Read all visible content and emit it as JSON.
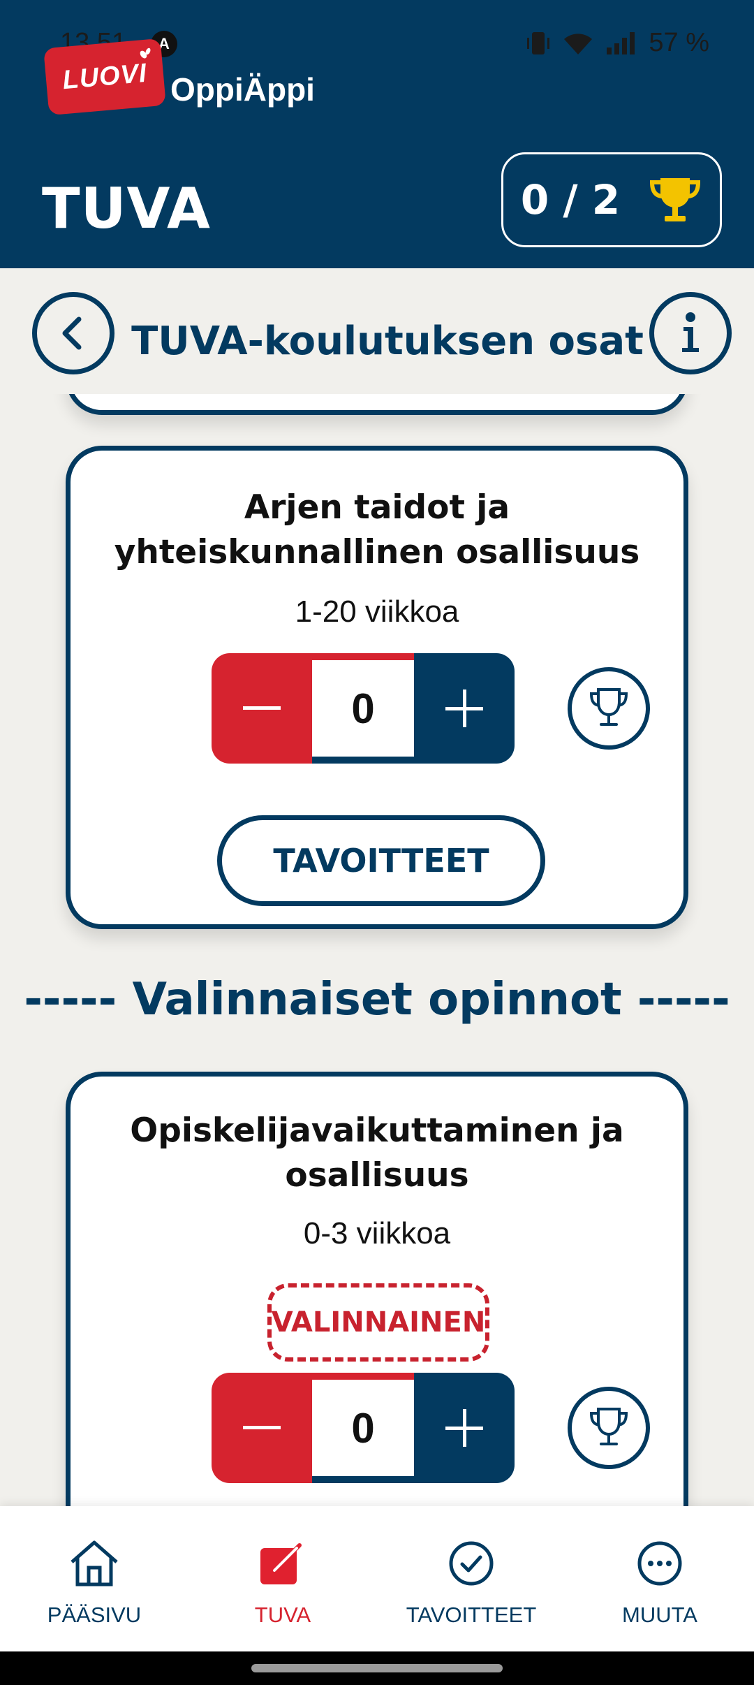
{
  "status_bar": {
    "time": "13.51",
    "battery": "57 %"
  },
  "app": {
    "logo_text": "LUOVI",
    "name": "OppiÄppi"
  },
  "header": {
    "title": "TUVA",
    "score": "0 / 2"
  },
  "subheader": {
    "title": "TUVA-koulutuksen osat"
  },
  "cards": [
    {
      "title_line1": "Arjen taidot ja",
      "title_line2": "yhteiskunnallinen osallisuus",
      "weeks": "1-20 viikkoa",
      "count": "0",
      "goals_label": "TAVOITTEET"
    },
    {
      "title_line1": "Opiskelijavaikuttaminen ja",
      "title_line2": "osallisuus",
      "weeks": "0-3 viikkoa",
      "badge": "VALINNAINEN",
      "count": "0"
    }
  ],
  "section_divider": "----- Valinnaiset opinnot -----",
  "bottom_nav": [
    {
      "label": "PÄÄSIVU",
      "icon": "home-icon"
    },
    {
      "label": "TUVA",
      "icon": "edit-note-icon",
      "active": true
    },
    {
      "label": "TAVOITTEET",
      "icon": "check-circle-icon"
    },
    {
      "label": "MUUTA",
      "icon": "more-dots-icon"
    }
  ],
  "colors": {
    "primary": "#033a60",
    "accent": "#d6232f",
    "background": "#f1f0ec",
    "trophy": "#f3c300"
  }
}
